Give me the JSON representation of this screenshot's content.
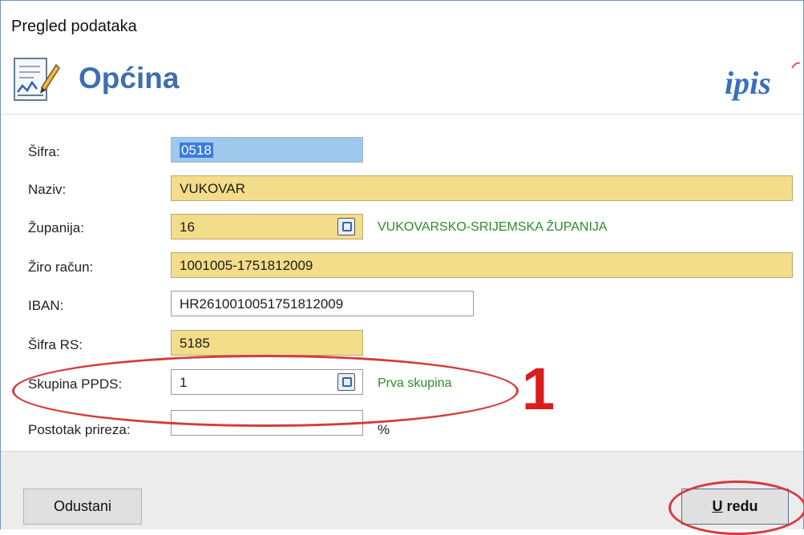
{
  "window": {
    "title": "Pregled podataka"
  },
  "header": {
    "title": "Općina",
    "brand": "ipis",
    "icon": "document-chart-icon"
  },
  "form": {
    "sifra": {
      "label": "Šifra:",
      "value": "0518"
    },
    "naziv": {
      "label": "Naziv:",
      "value": "VUKOVAR"
    },
    "zupanija": {
      "label": "Županija:",
      "value": "16",
      "description": "VUKOVARSKO-SRIJEMSKA ŽUPANIJA"
    },
    "ziro": {
      "label": "Žiro račun:",
      "value": "1001005-1751812009"
    },
    "iban": {
      "label": "IBAN:",
      "value": "HR2610010051751812009"
    },
    "sifra_rs": {
      "label": "Šifra RS:",
      "value": "5185"
    },
    "skupina_ppds": {
      "label": "Skupina PPDS:",
      "value": "1",
      "description": "Prva skupina"
    },
    "postotak": {
      "label": "Postotak prireza:",
      "value": "",
      "unit": "%"
    }
  },
  "annotation": {
    "number": "1"
  },
  "buttons": {
    "cancel": "Odustani",
    "ok": "U redu"
  },
  "colors": {
    "required_field": "#f3dd8a",
    "focused_field": "#9fc9ec",
    "header_title": "#3f6fae",
    "brand": "#3a6fc2",
    "lookup_text": "#2e8a2e",
    "annotation": "#d63a3a"
  }
}
